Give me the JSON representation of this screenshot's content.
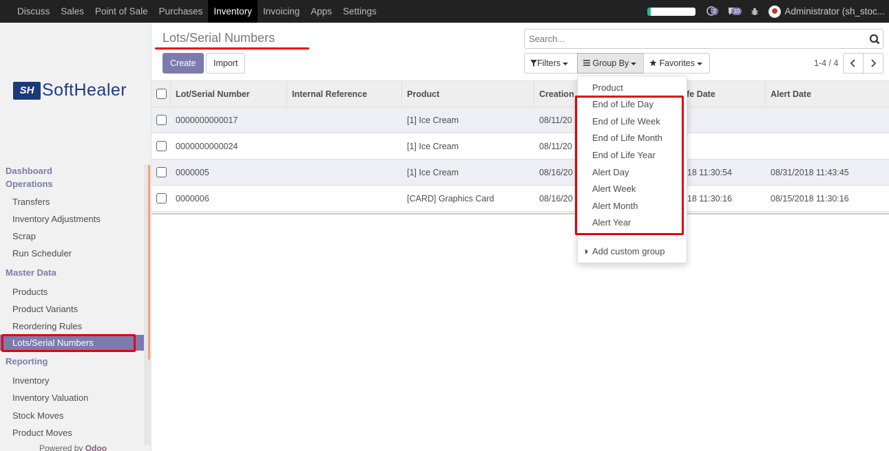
{
  "topbar": {
    "menu": [
      "Discuss",
      "Sales",
      "Point of Sale",
      "Purchases",
      "Inventory",
      "Invoicing",
      "Apps",
      "Settings"
    ],
    "active_index": 4,
    "activity_count": "2",
    "message_count": "10",
    "user": "Administrator (sh_stoc..."
  },
  "sidebar": {
    "logo_mark": "SH",
    "logo_text": "SoftHealer",
    "sections": [
      {
        "title": "Dashboard",
        "items": []
      },
      {
        "title": "Operations",
        "items": [
          "Transfers",
          "Inventory Adjustments",
          "Scrap",
          "Run Scheduler"
        ]
      },
      {
        "title": "Master Data",
        "items": [
          "Products",
          "Product Variants",
          "Reordering Rules",
          "Lots/Serial Numbers"
        ]
      },
      {
        "title": "Reporting",
        "items": [
          "Inventory",
          "Inventory Valuation",
          "Stock Moves",
          "Product Moves"
        ]
      }
    ],
    "active_item": "Lots/Serial Numbers",
    "powered_by": "Powered by",
    "powered_brand": "Odoo"
  },
  "control": {
    "title": "Lots/Serial Numbers",
    "create_label": "Create",
    "import_label": "Import",
    "search_placeholder": "Search...",
    "filters_label": "Filters",
    "groupby_label": "Group By",
    "favorites_label": "Favorites",
    "pager": "1-4 / 4"
  },
  "table": {
    "columns": [
      "Lot/Serial Number",
      "Internal Reference",
      "Product",
      "Creation",
      "Life Date",
      "Alert Date"
    ],
    "rows": [
      {
        "lot": "0000000000017",
        "ref": "",
        "product": "[1] Ice Cream",
        "creation": "08/11/20",
        "life": "",
        "alert": ""
      },
      {
        "lot": "0000000000024",
        "ref": "",
        "product": "[1] Ice Cream",
        "creation": "08/11/20",
        "life": "",
        "alert": ""
      },
      {
        "lot": "0000005",
        "ref": "",
        "product": "[1] Ice Cream",
        "creation": "08/16/20",
        "life": "2018 11:30:54",
        "alert": "08/31/2018 11:43:45"
      },
      {
        "lot": "0000006",
        "ref": "",
        "product": "[CARD] Graphics Card",
        "creation": "08/16/20",
        "life": "2018 11:30:16",
        "alert": "08/15/2018 11:30:16"
      }
    ]
  },
  "groupby_menu": {
    "options": [
      "Product",
      "End of Life Day",
      "End of Life Week",
      "End of Life Month",
      "End of Life Year",
      "Alert Day",
      "Alert Week",
      "Alert Month",
      "Alert Year"
    ],
    "add_custom": "Add custom group"
  },
  "colors": {
    "accent": "#7c7bad",
    "highlight": "#e3000b",
    "topbar": "#222222"
  }
}
